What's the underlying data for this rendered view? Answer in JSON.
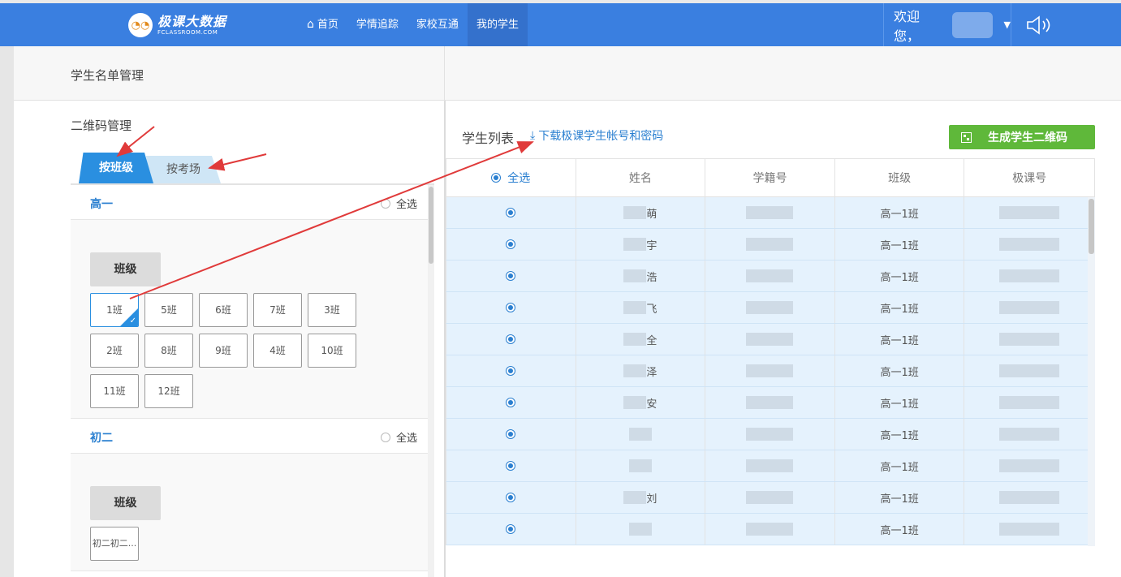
{
  "topbar": {
    "logo_main": "极课大数据",
    "logo_sub": "FCLASSROOM.COM",
    "nav": [
      "首页",
      "学情追踪",
      "家校互通",
      "我的学生"
    ],
    "active_nav": "我的学生",
    "welcome": "欢迎您，"
  },
  "header": {
    "title": "学生名单管理"
  },
  "left": {
    "qr_title": "二维码管理",
    "tabs": [
      "按班级",
      "按考场"
    ],
    "grades": [
      {
        "name": "高一",
        "select_all": "全选",
        "class_label": "班级",
        "classes": [
          "1班",
          "5班",
          "6班",
          "7班",
          "3班",
          "2班",
          "8班",
          "9班",
          "4班",
          "10班",
          "11班",
          "12班"
        ]
      },
      {
        "name": "初二",
        "select_all": "全选",
        "class_label": "班级",
        "classes": [
          "初二初二..."
        ]
      }
    ]
  },
  "right": {
    "list_title": "学生列表",
    "download_link": "下载极课学生帐号和密码",
    "generate_button": "生成学生二维码",
    "columns": [
      "全选",
      "姓名",
      "学籍号",
      "班级",
      "极课号"
    ],
    "rows": [
      {
        "name": "萌",
        "class": "高一1班"
      },
      {
        "name": "宇",
        "class": "高一1班"
      },
      {
        "name": "浩",
        "class": "高一1班"
      },
      {
        "name": "飞",
        "class": "高一1班"
      },
      {
        "name": "全",
        "class": "高一1班"
      },
      {
        "name": "泽",
        "class": "高一1班"
      },
      {
        "name": "安",
        "class": "高一1班"
      },
      {
        "name": "",
        "class": "高一1班"
      },
      {
        "name": "",
        "class": "高一1班"
      },
      {
        "name": "刘",
        "class": "高一1班"
      },
      {
        "name": "",
        "class": "高一1班"
      }
    ]
  },
  "colors": {
    "brand": "#3a7fe0",
    "accent": "#2a8fe0",
    "green": "#5fb83a",
    "row": "#e5f2fd",
    "annotation": "#e03a3a"
  }
}
